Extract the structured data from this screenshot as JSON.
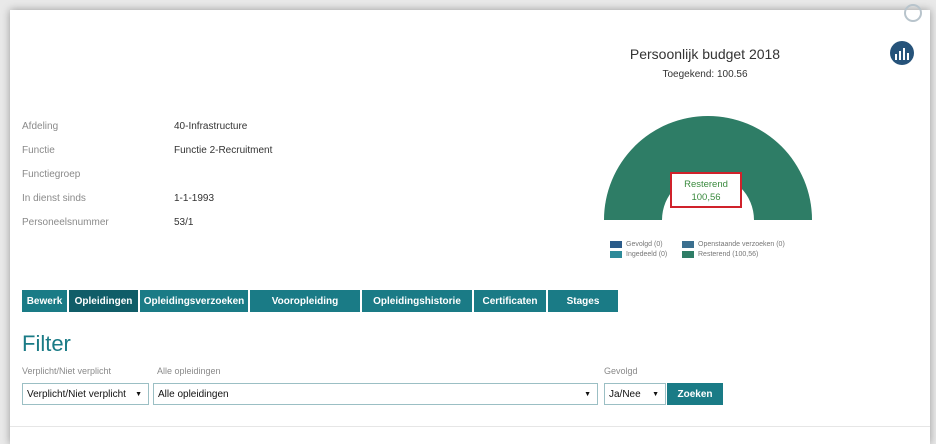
{
  "profile": {
    "rows": [
      {
        "label": "Afdeling",
        "value": "40-Infrastructure"
      },
      {
        "label": "Functie",
        "value": "Functie 2-Recruitment"
      },
      {
        "label": "Functiegroep",
        "value": ""
      },
      {
        "label": "In dienst sinds",
        "value": "1-1-1993"
      },
      {
        "label": "Personeelsnummer",
        "value": "53/1"
      }
    ]
  },
  "budget": {
    "title": "Persoonlijk budget 2018",
    "granted": "Toegekend: 100.56",
    "remaining_label": "Resterend",
    "remaining_value": "100,56",
    "remaining_fraction": 1.0,
    "colors": {
      "gevolgd": "#2b5c8a",
      "ingedeeld": "#2d8a99",
      "openstaande": "#3b6f8f",
      "resterend": "#2e7d66"
    },
    "legend": {
      "gevolgd": "Gevolgd (0)",
      "ingedeeld": "Ingedeeld (0)",
      "openstaande": "Openstaande verzoeken (0)",
      "resterend": "Resterend (100,56)"
    },
    "stats_icon": "bar-chart-icon"
  },
  "tabs": [
    {
      "label": "Bewerk",
      "active": false
    },
    {
      "label": "Opleidingen",
      "active": true
    },
    {
      "label": "Opleidingsverzoeken",
      "active": false
    },
    {
      "label": "Vooropleiding",
      "active": false
    },
    {
      "label": "Opleidingshistorie",
      "active": false
    },
    {
      "label": "Certificaten",
      "active": false
    },
    {
      "label": "Stages",
      "active": false
    }
  ],
  "filter": {
    "title": "Filter",
    "verplicht_label": "Verplicht/Niet verplicht",
    "verplicht_value": "Verplicht/Niet verplicht",
    "opleidingen_label": "Alle opleidingen",
    "opleidingen_value": "Alle opleidingen",
    "gevolgd_label": "Gevolgd",
    "gevolgd_value": "Ja/Nee",
    "search_button": "Zoeken"
  }
}
